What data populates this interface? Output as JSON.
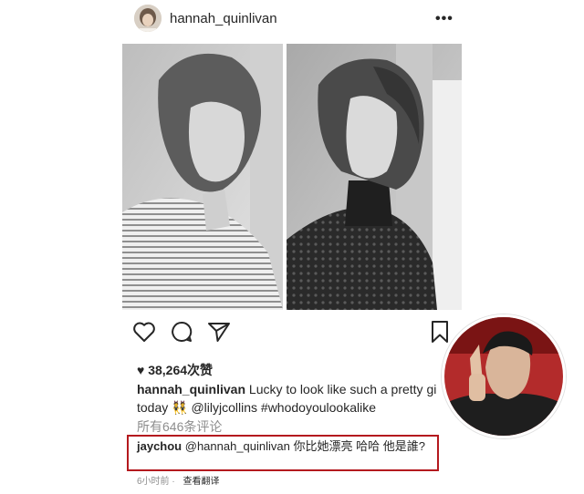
{
  "post": {
    "username": "hannah_quinlivan",
    "likes": "38,264次赞",
    "caption": {
      "username": "hannah_quinlivan",
      "text_line1": "Lucky to look like such a pretty gi",
      "text_line2": "today 👯 @lilyjcollins #whodoyoulookalike"
    },
    "view_comments": "所有646条评论",
    "highlighted_comment": {
      "username": "jaychou",
      "text": "@hannah_quinlivan 你比她漂亮 哈哈 他是誰?"
    },
    "time": "6小时前",
    "translate": "查看翻译"
  },
  "icons": {
    "more": "more-options-icon",
    "like": "heart-icon",
    "comment": "comment-icon",
    "share": "send-icon",
    "save": "bookmark-icon"
  },
  "colors": {
    "highlight_border": "#b4191e",
    "muted_text": "#8e8e8e",
    "text": "#262626"
  }
}
